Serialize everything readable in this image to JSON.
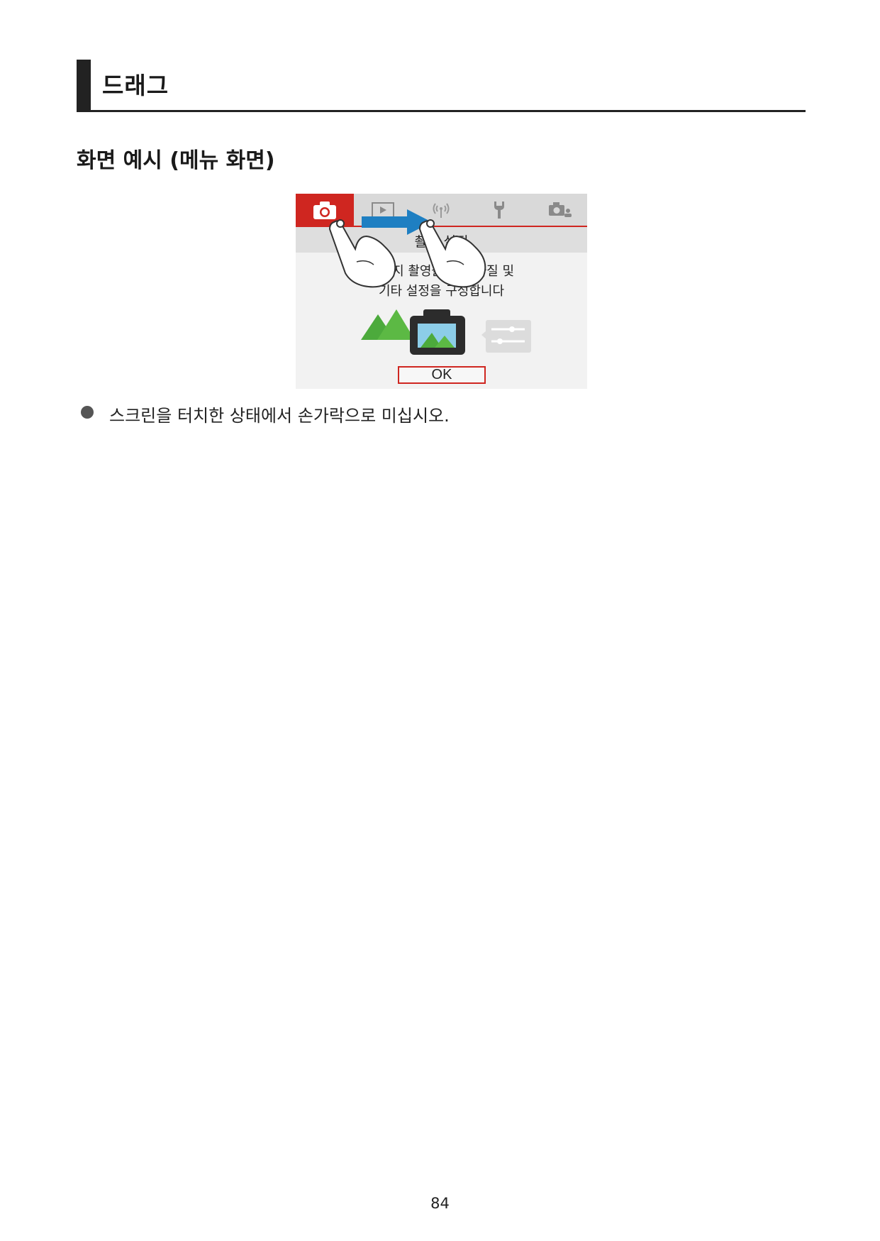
{
  "section": {
    "title": "드래그"
  },
  "subheading": "화면 예시 (메뉴 화면)",
  "screen": {
    "tabs": [
      {
        "icon": "camera-icon",
        "active": true
      },
      {
        "icon": "play-icon",
        "active": false
      },
      {
        "icon": "wireless-icon",
        "active": false
      },
      {
        "icon": "wrench-icon",
        "active": false
      },
      {
        "icon": "my-menu-camera-icon",
        "active": false
      }
    ],
    "title": "촬영 설정",
    "description": [
      "이미지 촬영을 위한 화질 및",
      "기타 설정을 구성합니다"
    ],
    "ok_label": "OK",
    "accent_color": "#cf2620",
    "arrow_color": "#1e7fc2"
  },
  "bullet_text": "스크린을 터치한 상태에서 손가락으로 미십시오.",
  "page_number": "84"
}
